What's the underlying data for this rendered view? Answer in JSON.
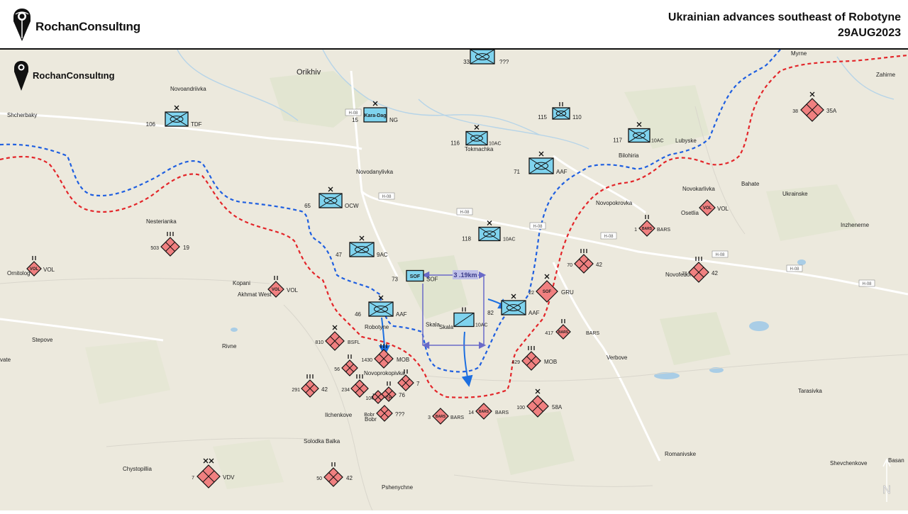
{
  "header": {
    "brand": "RochanConsultıng",
    "title": "Ukrainian advances southeast of Robotyne",
    "date": "29AUG2023"
  },
  "map_brand": "RochanConsultıng",
  "colors": {
    "ukraine_line": "#1f5fe0",
    "russia_line": "#e3262a",
    "ua_unit_fill": "#7fd3ee",
    "ru_unit_fill": "#f08080",
    "advance_arrow": "#1d6fe0",
    "measure": "#6a6ac8"
  },
  "towns": [
    {
      "label": "Orikhiv"
    },
    {
      "label": "Novoandriivka"
    },
    {
      "label": "Shcherbaky"
    },
    {
      "label": "Tokmachka"
    },
    {
      "label": "Bilohiria"
    },
    {
      "label": "Lubyske"
    },
    {
      "label": "Myrne"
    },
    {
      "label": "Zahirne"
    },
    {
      "label": "Novodanylivka"
    },
    {
      "label": "Novokarlivka"
    },
    {
      "label": "Bahate"
    },
    {
      "label": "Ukrainske"
    },
    {
      "label": "Novopokrovka"
    },
    {
      "label": "Osetlia"
    },
    {
      "label": "Inzhenerne"
    },
    {
      "label": "Nesterianka"
    },
    {
      "label": "Kopani"
    },
    {
      "label": "Akhmat West"
    },
    {
      "label": "Ornitolog"
    },
    {
      "label": "Robotyne"
    },
    {
      "label": "Novoprokopivka"
    },
    {
      "label": "Skala"
    },
    {
      "label": "Novofedorivka"
    },
    {
      "label": "Verbove"
    },
    {
      "label": "Stepove"
    },
    {
      "label": "Rivne"
    },
    {
      "label": "Ilchenkove"
    },
    {
      "label": "Bobr"
    },
    {
      "label": "Solodka Balka"
    },
    {
      "label": "Tarasivka"
    },
    {
      "label": "Romanivske"
    },
    {
      "label": "Shevchenkove"
    },
    {
      "label": "Chystopillia"
    },
    {
      "label": "Pshenychne"
    },
    {
      "label": "Basan"
    },
    {
      "label": "vate"
    }
  ],
  "roads": [
    {
      "label": "H-08"
    },
    {
      "label": "H-08"
    },
    {
      "label": "H-08"
    },
    {
      "label": "H-08"
    },
    {
      "label": "H-08"
    },
    {
      "label": "H-08"
    },
    {
      "label": "H-08"
    },
    {
      "label": "H-08"
    }
  ],
  "ua_units": [
    {
      "num": "33",
      "name": "???",
      "echelon": "X"
    },
    {
      "num": "106",
      "name": "TDF",
      "echelon": "X"
    },
    {
      "num": "15",
      "name": "NG",
      "inner": "Kara-Dag",
      "echelon": "X"
    },
    {
      "num": "115",
      "name": "110",
      "echelon": "II"
    },
    {
      "num": "116",
      "name": "10AC",
      "echelon": "X"
    },
    {
      "num": "117",
      "name": "10AC",
      "echelon": "X"
    },
    {
      "num": "71",
      "name": "AAF",
      "echelon": "X"
    },
    {
      "num": "65",
      "name": "OCW",
      "echelon": "X"
    },
    {
      "num": "118",
      "name": "10AC",
      "echelon": "X"
    },
    {
      "num": "47",
      "name": "9AC",
      "echelon": "X"
    },
    {
      "num": "73",
      "name": "SOF",
      "inner": "SOF",
      "echelon": ""
    },
    {
      "num": "46",
      "name": "AAF",
      "echelon": "X"
    },
    {
      "num": "82",
      "name": "AAF",
      "echelon": "X"
    },
    {
      "num": "Skala",
      "name": "10AC",
      "echelon": "II"
    }
  ],
  "ru_units": [
    {
      "num": "38",
      "name": "35A",
      "echelon": "X"
    },
    {
      "num": "",
      "name": "VOL",
      "inner": "VOL",
      "echelon": ""
    },
    {
      "num": "1",
      "name": "BARS",
      "inner": "BARS",
      "echelon": "II"
    },
    {
      "num": "70",
      "name": "42",
      "echelon": "III"
    },
    {
      "num": "71",
      "name": "42",
      "echelon": "III"
    },
    {
      "num": "22",
      "name": "GRU",
      "inner": "SOF",
      "echelon": "X"
    },
    {
      "num": "503",
      "name": "19",
      "echelon": "III"
    },
    {
      "num": "",
      "name": "VOL",
      "inner": "VOL",
      "echelon": "II"
    },
    {
      "num": "",
      "name": "VOL",
      "inner": "VOL",
      "echelon": "II"
    },
    {
      "num": "417",
      "name": "BARS",
      "inner": "BARS",
      "echelon": "II"
    },
    {
      "num": "810",
      "name": "BSFL",
      "echelon": "X"
    },
    {
      "num": "1430",
      "name": "MOB",
      "echelon": "III"
    },
    {
      "num": "429",
      "name": "MOB",
      "echelon": "III"
    },
    {
      "num": "56",
      "name": "",
      "echelon": "II"
    },
    {
      "num": "291",
      "name": "42",
      "echelon": "III"
    },
    {
      "num": "234",
      "name": "",
      "echelon": "III"
    },
    {
      "num": "108",
      "name": "76",
      "echelon": "II"
    },
    {
      "num": "",
      "name": "7",
      "echelon": "II"
    },
    {
      "num": "104",
      "name": "76",
      "echelon": ""
    },
    {
      "num": "Bobr",
      "name": "???",
      "echelon": ""
    },
    {
      "num": "3",
      "name": "BARS",
      "inner": "BARS",
      "echelon": ""
    },
    {
      "num": "14",
      "name": "BARS",
      "inner": "BARS",
      "echelon": ""
    },
    {
      "num": "100",
      "name": "58A",
      "echelon": "X"
    },
    {
      "num": "7",
      "name": "VDV",
      "echelon": "XX"
    },
    {
      "num": "50",
      "name": "42",
      "echelon": "II"
    }
  ],
  "measure_label": "3 .19km",
  "north_label": "N"
}
